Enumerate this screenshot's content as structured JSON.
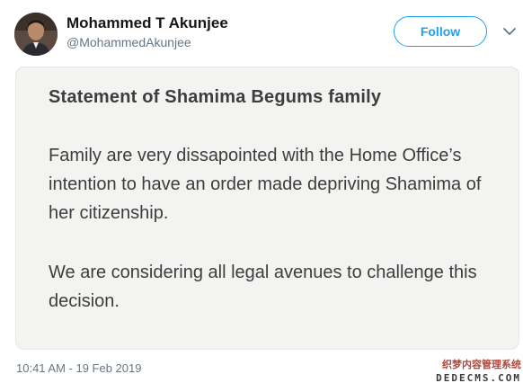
{
  "author": {
    "display_name": "Mohammed T Akunjee",
    "handle": "@MohammedAkunjee"
  },
  "follow_label": "Follow",
  "icons": {
    "menu": "chevron-down-icon",
    "avatar": "avatar"
  },
  "colors": {
    "accent": "#1da1f2",
    "card_bg": "#f3f3f2",
    "card_text": "#3d3d3d",
    "muted": "#657786"
  },
  "card": {
    "title": "Statement of Shamima Begums family",
    "paragraph_1": "Family are very dissapointed with the Home Office’s intention to have an order made depriving Shamima of her citizenship.",
    "paragraph_2": "We are considering all legal avenues to challenge this decision."
  },
  "timestamp": "10:41 AM - 19 Feb 2019",
  "watermark": {
    "line_1": "织梦内容管理系统",
    "line_2": "DEDECMS.COM"
  }
}
